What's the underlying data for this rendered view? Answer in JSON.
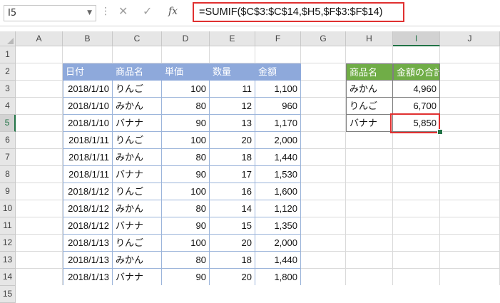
{
  "formula_bar": {
    "name_box": "I5",
    "formula": "=SUMIF($C$3:$C$14,$H5,$F$3:$F$14)"
  },
  "columns": [
    "A",
    "B",
    "C",
    "D",
    "E",
    "F",
    "G",
    "H",
    "I",
    "J"
  ],
  "selected_column": "I",
  "selected_row": "5",
  "rows": [
    "1",
    "2",
    "3",
    "4",
    "5",
    "6",
    "7",
    "8",
    "9",
    "10",
    "11",
    "12",
    "13",
    "14",
    "15"
  ],
  "table": {
    "headers": [
      "日付",
      "商品名",
      "単価",
      "数量",
      "金額"
    ],
    "rows": [
      [
        "2018/1/10",
        "りんご",
        "100",
        "11",
        "1,100"
      ],
      [
        "2018/1/10",
        "みかん",
        "80",
        "12",
        "960"
      ],
      [
        "2018/1/10",
        "バナナ",
        "90",
        "13",
        "1,170"
      ],
      [
        "2018/1/11",
        "りんご",
        "100",
        "20",
        "2,000"
      ],
      [
        "2018/1/11",
        "みかん",
        "80",
        "18",
        "1,440"
      ],
      [
        "2018/1/11",
        "バナナ",
        "90",
        "17",
        "1,530"
      ],
      [
        "2018/1/12",
        "りんご",
        "100",
        "16",
        "1,600"
      ],
      [
        "2018/1/12",
        "みかん",
        "80",
        "14",
        "1,120"
      ],
      [
        "2018/1/12",
        "バナナ",
        "90",
        "15",
        "1,350"
      ],
      [
        "2018/1/13",
        "りんご",
        "100",
        "20",
        "2,000"
      ],
      [
        "2018/1/13",
        "みかん",
        "80",
        "18",
        "1,440"
      ],
      [
        "2018/1/13",
        "バナナ",
        "90",
        "20",
        "1,800"
      ]
    ]
  },
  "summary": {
    "headers": [
      "商品名",
      "金額の合計"
    ],
    "rows": [
      [
        "みかん",
        "4,960"
      ],
      [
        "りんご",
        "6,700"
      ],
      [
        "バナナ",
        "5,850"
      ]
    ]
  },
  "colors": {
    "table_header": "#8ea9db",
    "summary_header": "#70ad47",
    "highlight": "#e03030",
    "selection": "#217346"
  }
}
